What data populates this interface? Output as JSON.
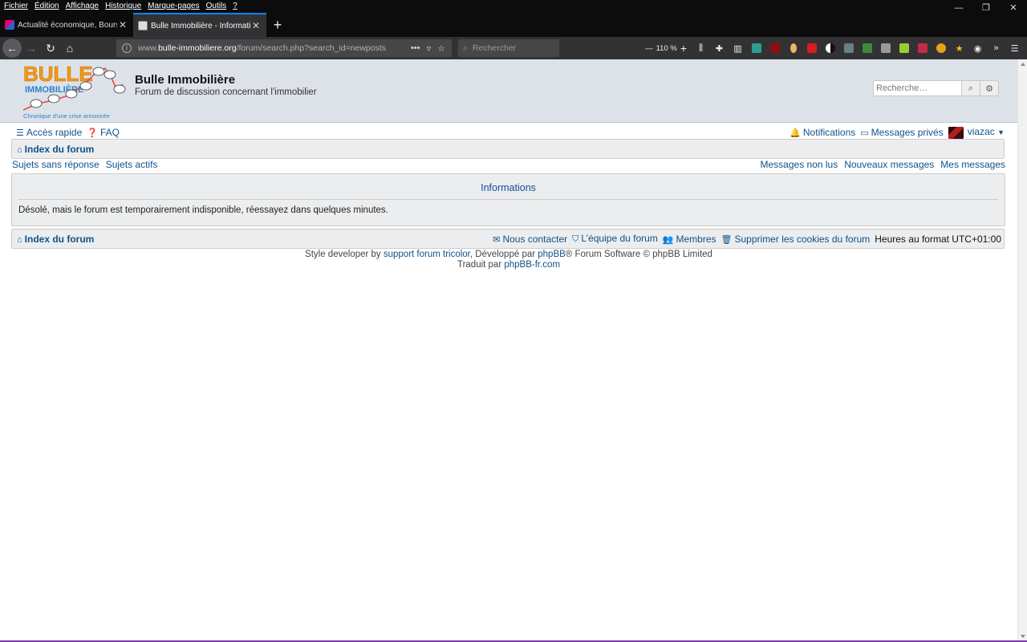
{
  "browser": {
    "menu": [
      "Fichier",
      "Édition",
      "Affichage",
      "Historique",
      "Marque-pages",
      "Outils",
      "?"
    ],
    "window_controls": [
      "—",
      "❐",
      "✕"
    ],
    "tabs": [
      {
        "title": "Actualité économique, Bourse, Sta",
        "active": false
      },
      {
        "title": "Bulle Immobilière - Informations",
        "active": true
      }
    ],
    "new_tab": "+",
    "url": {
      "prefix": "www.",
      "domain": "bulle-immobiliere.org",
      "path": "/forum/search.php?search_id=newposts"
    },
    "search_placeholder": "Rechercher",
    "zoom": "110 %"
  },
  "site": {
    "logo_line1": "BULLE",
    "logo_line2": "IMMOBILIÈRE",
    "logo_tagline": "Chronique d'une crise annoncée",
    "title": "Bulle Immobilière",
    "description": "Forum de discussion concernant l'immobilier",
    "search_placeholder": "Recherche…"
  },
  "nav": {
    "quick_access": "Accès rapide",
    "faq": "FAQ",
    "notifications": "Notifications",
    "private_messages": "Messages privés",
    "username": "viazac"
  },
  "breadcrumb": {
    "index": "Index du forum"
  },
  "quicklinks": {
    "left": [
      "Sujets sans réponse",
      "Sujets actifs"
    ],
    "right": [
      "Messages non lus",
      "Nouveaux messages",
      "Mes messages"
    ]
  },
  "panel": {
    "title": "Informations",
    "message": "Désolé, mais le forum est temporairement indisponible, réessayez dans quelques minutes."
  },
  "footer_bar": {
    "contact": "Nous contacter",
    "team": "L’équipe du forum",
    "members": "Membres",
    "delete_cookies": "Supprimer les cookies du forum",
    "timezone": "Heures au format UTC+01:00"
  },
  "footer": {
    "style_prefix": "Style developer by ",
    "style_link": "support forum tricolor",
    "dev_prefix": ", Développé par ",
    "dev_link": "phpBB",
    "dev_suffix": "® Forum Software © phpBB Limited",
    "translated_prefix": "Traduit par ",
    "translated_link": "phpBB-fr.com"
  },
  "colors": {
    "link": "#105289",
    "header_bg": "#dde2e9",
    "panel_bg": "#ecedee",
    "chrome_dark": "#0c0c0d",
    "chrome_toolbar": "#323234",
    "tab_accent": "#0a84ff"
  }
}
